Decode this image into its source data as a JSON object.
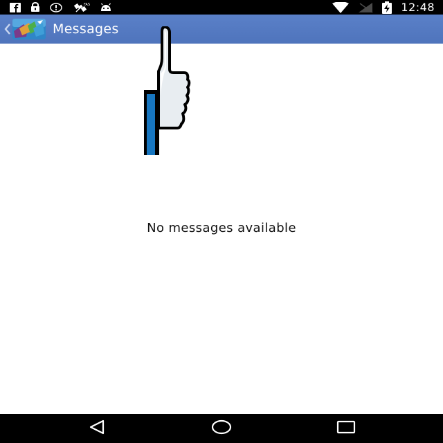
{
  "status_bar": {
    "left_icons": [
      "facebook-icon",
      "lock-icon",
      "alert-icon",
      "satellite-icon",
      "android-icon"
    ],
    "right_icons": [
      "wifi-icon",
      "signal-icon",
      "battery-charging-icon"
    ],
    "time": "12:48"
  },
  "action_bar": {
    "title": "Messages",
    "up_icon": "chevron-left-icon",
    "logo_icon": "app-logo-icon",
    "background_color": "#5479c2"
  },
  "content": {
    "illustration_icon": "thumbs-up-icon",
    "empty_text": "No messages available"
  },
  "nav_bar": {
    "buttons": [
      "back-triangle-icon",
      "home-circle-icon",
      "recents-square-icon"
    ]
  }
}
